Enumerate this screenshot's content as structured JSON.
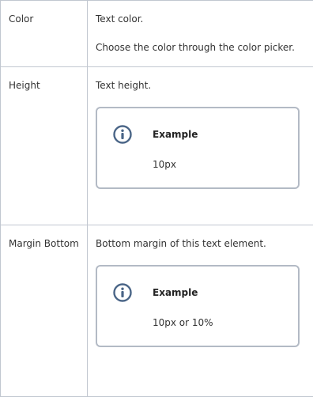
{
  "rows": [
    {
      "name": "Color",
      "description": [
        "Text color.",
        "Choose the color through the color picker."
      ]
    },
    {
      "name": "Height",
      "description": [
        "Text height."
      ],
      "panel": {
        "icon": "info-icon",
        "title": "Example",
        "body": "10px"
      }
    },
    {
      "name": "Margin Bottom",
      "description": [
        "Bottom margin of this text element."
      ],
      "panel": {
        "icon": "info-icon",
        "title": "Example",
        "body": "10px or 10%"
      }
    }
  ],
  "colors": {
    "border": "#c1c7d0",
    "panel_border": "#b3bac5",
    "icon": "#4a6587",
    "text": "#333333"
  }
}
